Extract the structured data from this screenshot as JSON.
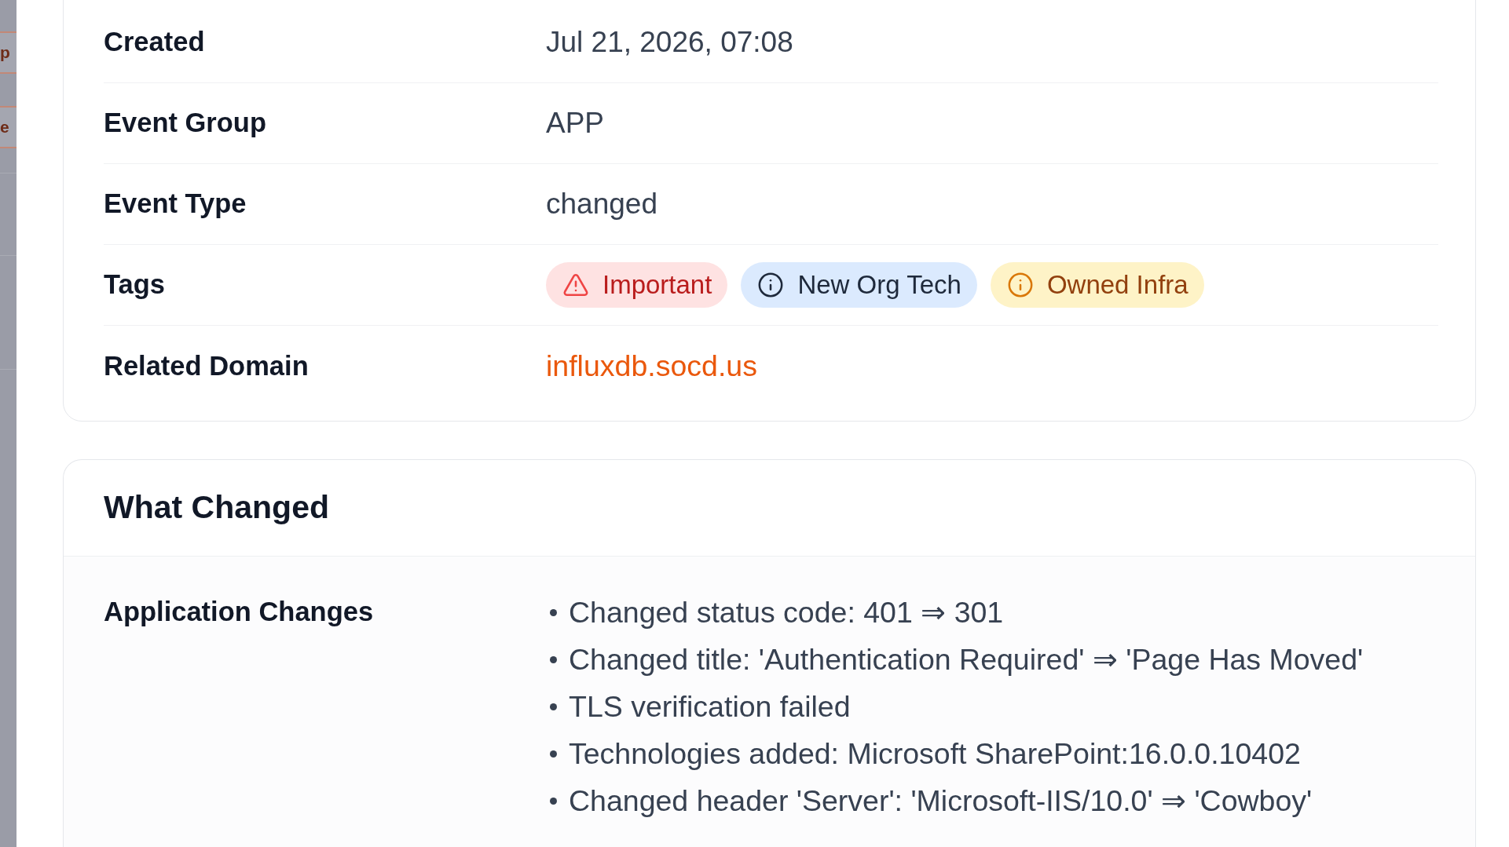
{
  "background_tabs": [
    {
      "label": "p"
    },
    {
      "label": "e"
    }
  ],
  "details": {
    "rows": [
      {
        "label": "Created",
        "kind": "text",
        "value": "Jul 21, 2026, 07:08"
      },
      {
        "label": "Event Group",
        "kind": "text",
        "value": "APP"
      },
      {
        "label": "Event Type",
        "kind": "text",
        "value": "changed"
      },
      {
        "label": "Tags",
        "kind": "tags",
        "tags": [
          {
            "label": "Important",
            "kind": "danger",
            "color": "#fee2e2"
          },
          {
            "label": "New Org Tech",
            "kind": "info",
            "color": "#dbeafe"
          },
          {
            "label": "Owned Infra",
            "kind": "warning",
            "color": "#fef3c7"
          }
        ]
      },
      {
        "label": "Related Domain",
        "kind": "link",
        "value": "influxdb.socd.us"
      }
    ]
  },
  "what_changed": {
    "title": "What Changed",
    "rows": [
      {
        "label": "Application Changes",
        "items": [
          "Changed status code: 401 ⇒ 301",
          "Changed title: 'Authentication Required' ⇒ 'Page Has Moved'",
          "TLS verification failed",
          "Technologies added: Microsoft SharePoint:16.0.0.10402",
          "Changed header 'Server': 'Microsoft-IIS/10.0' ⇒ 'Cowboy'"
        ]
      }
    ]
  }
}
